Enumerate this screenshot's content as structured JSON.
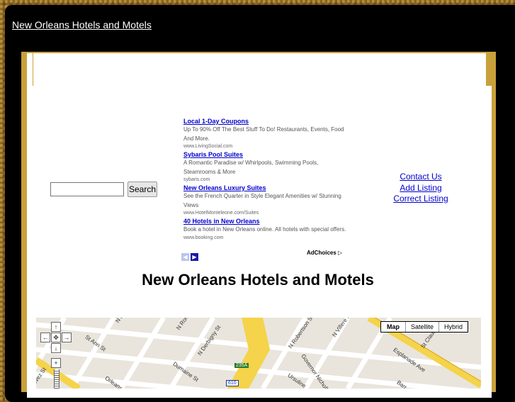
{
  "site": {
    "title": "New Orleans Hotels and Motels"
  },
  "search": {
    "placeholder": "",
    "value": "",
    "button_label": "Search"
  },
  "ads": [
    {
      "title": "Local 1-Day Coupons",
      "desc": "Up To 90% Off The Best Stuff To Do! Restaurants, Events, Food And More.",
      "url": "www.LivingSocial.com"
    },
    {
      "title": "Sybaris Pool Suites",
      "desc": "A Romantic Paradise w/ Whirlpools, Swimming Pools, Steamrooms & More",
      "url": "sybaris.com"
    },
    {
      "title": "New Orleans Luxury Suites",
      "desc": "See the French Quarter in Style Elegant Amenities w/ Stunning Views",
      "url": "www.HotelMonteleone.com/Suites"
    },
    {
      "title": "40 Hotels in New Orleans",
      "desc": "Book a hotel in New Orleans online. All hotels with special offers.",
      "url": "www.booking.com"
    }
  ],
  "adchoices": {
    "label": "AdChoices",
    "icon": "adchoices-triangle-icon"
  },
  "links": {
    "contact": "Contact Us ",
    "add": "Add Listing",
    "correct": "Correct Listing"
  },
  "page": {
    "title": "New Orleans Hotels and Motels"
  },
  "map": {
    "types": [
      "Map",
      "Satellite",
      "Hybrid"
    ],
    "selected_type": "Map",
    "streets": [
      "St Ann St",
      "N Johnson",
      "N Roman St",
      "N Derbigny St",
      "Dumaine St",
      "N Robertson St",
      "Governor Nicholls St",
      "N Villere St",
      "Ursuline",
      "Esplanade Ave",
      "St Claude",
      "Barr",
      "Orleans",
      "alvez St",
      "235A",
      "610"
    ],
    "colors": {
      "road": "#ffffff",
      "highway": "#f5d34a",
      "block": "#e9e5dc"
    }
  }
}
